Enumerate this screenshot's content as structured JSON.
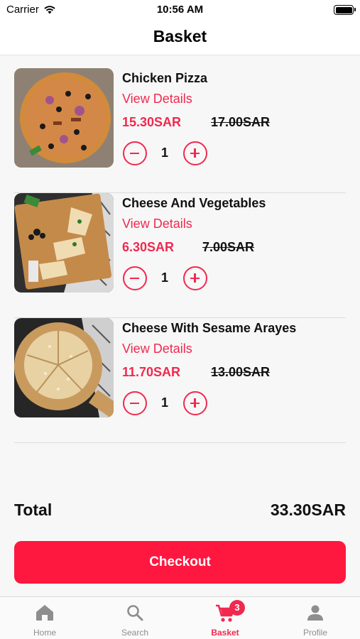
{
  "status_bar": {
    "carrier": "Carrier",
    "time": "10:56 AM"
  },
  "header": {
    "title": "Basket"
  },
  "items": [
    {
      "name": "Chicken Pizza",
      "details_label": "View Details",
      "price": "15.30SAR",
      "old_price": "17.00SAR",
      "quantity": "1"
    },
    {
      "name": "Cheese And Vegetables",
      "details_label": "View Details",
      "price": "6.30SAR",
      "old_price": "7.00SAR",
      "quantity": "1"
    },
    {
      "name": "Cheese With Sesame Arayes",
      "details_label": "View Details",
      "price": "11.70SAR",
      "old_price": "13.00SAR",
      "quantity": "1"
    }
  ],
  "total": {
    "label": "Total",
    "value": "33.30SAR"
  },
  "checkout_label": "Checkout",
  "tabbar": {
    "tabs": [
      {
        "label": "Home",
        "icon": "home-icon"
      },
      {
        "label": "Search",
        "icon": "search-icon"
      },
      {
        "label": "Basket",
        "icon": "cart-icon",
        "badge": "3",
        "active": true
      },
      {
        "label": "Profile",
        "icon": "person-icon"
      }
    ]
  },
  "colors": {
    "accent": "#f0294f",
    "checkout": "#fe173f",
    "inactive": "#8e8e8e"
  }
}
